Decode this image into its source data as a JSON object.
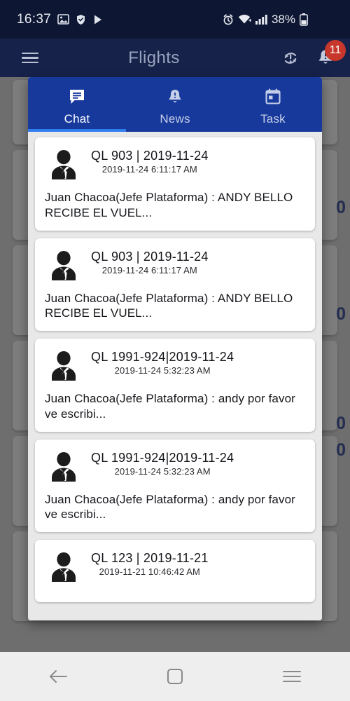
{
  "status_bar": {
    "clock": "16:37",
    "battery_percent": "38%",
    "left_icons": [
      "image-icon",
      "shield-icon",
      "play-store-icon"
    ],
    "right_icons": [
      "alarm-icon",
      "wifi-icon",
      "signal-icon",
      "battery-icon"
    ]
  },
  "app_bar": {
    "title": "Flights",
    "menu_icon": "hamburger-menu-icon",
    "sync_icon": "sync-alert-icon",
    "notification_icon": "bell-icon",
    "notification_count": "11"
  },
  "dialog": {
    "tabs": [
      {
        "label": "Chat",
        "icon": "chat-bubble-icon",
        "active": true
      },
      {
        "label": "News",
        "icon": "bell-alert-icon",
        "active": false
      },
      {
        "label": "Task",
        "icon": "calendar-icon",
        "active": false
      }
    ],
    "messages": [
      {
        "flight": "QL  903 | 2019-11-24",
        "timestamp": "2019-11-24 6:11:17 AM",
        "body": "Juan Chacoa(Jefe Plataforma) : ANDY BELLO RECIBE EL VUEL...",
        "avatar": "person-avatar-icon"
      },
      {
        "flight": "QL  903 | 2019-11-24",
        "timestamp": "2019-11-24 6:11:17 AM",
        "body": "Juan Chacoa(Jefe Plataforma) : ANDY BELLO RECIBE EL VUEL...",
        "avatar": "person-avatar-icon"
      },
      {
        "flight": "QL  1991-924|2019-11-24",
        "timestamp": "2019-11-24 5:32:23 AM",
        "body": "Juan Chacoa(Jefe Plataforma) : andy por favor ve escribi...",
        "avatar": "person-avatar-icon"
      },
      {
        "flight": "QL  1991-924|2019-11-24",
        "timestamp": "2019-11-24 5:32:23 AM",
        "body": "Juan Chacoa(Jefe Plataforma) : andy por favor ve escribi...",
        "avatar": "person-avatar-icon"
      },
      {
        "flight": "QL  123 | 2019-11-21",
        "timestamp": "2019-11-21 10:46:42 AM",
        "body": "",
        "avatar": "person-avatar-icon"
      }
    ]
  },
  "backdrop": {
    "partial_values": [
      "0",
      "0",
      "0",
      "0"
    ]
  },
  "nav_bar": {
    "back": "back-arrow-icon",
    "home": "home-square-icon",
    "recents": "recents-icon"
  },
  "colors": {
    "status_bar": "#0d1733",
    "app_bar": "#16224a",
    "tab_bar": "#17399c",
    "tab_indicator": "#2f7ef0",
    "badge": "#c7372b",
    "backdrop": "#6e6e6e"
  }
}
